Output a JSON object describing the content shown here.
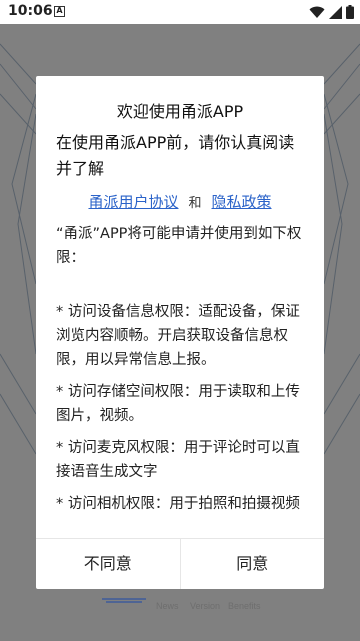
{
  "status_bar": {
    "time": "10:06",
    "notif_icon": "A"
  },
  "background_nav": {
    "items": [
      "News",
      "Version",
      "Benefits"
    ]
  },
  "dialog": {
    "title": "欢迎使用甬派APP",
    "lead": "在使用甬派APP前，请你认真阅读并了解",
    "user_agreement": "甬派用户协议",
    "and": "和",
    "privacy_policy": "隐私政策",
    "permissions": [
      "“甬派”APP将可能申请并使用到如下权限：",
      "* 访问设备信息权限：适配设备，保证浏览内容顺畅。开启获取设备信息权限，用以异常信息上报。",
      "* 访问存储空间权限：用于读取和上传图片，视频。",
      "* 访问麦克风权限：用于评论时可以直接语音生成文字",
      "* 访问相机权限：用于拍照和拍摄视频"
    ],
    "disagree": "不同意",
    "agree": "同意"
  }
}
